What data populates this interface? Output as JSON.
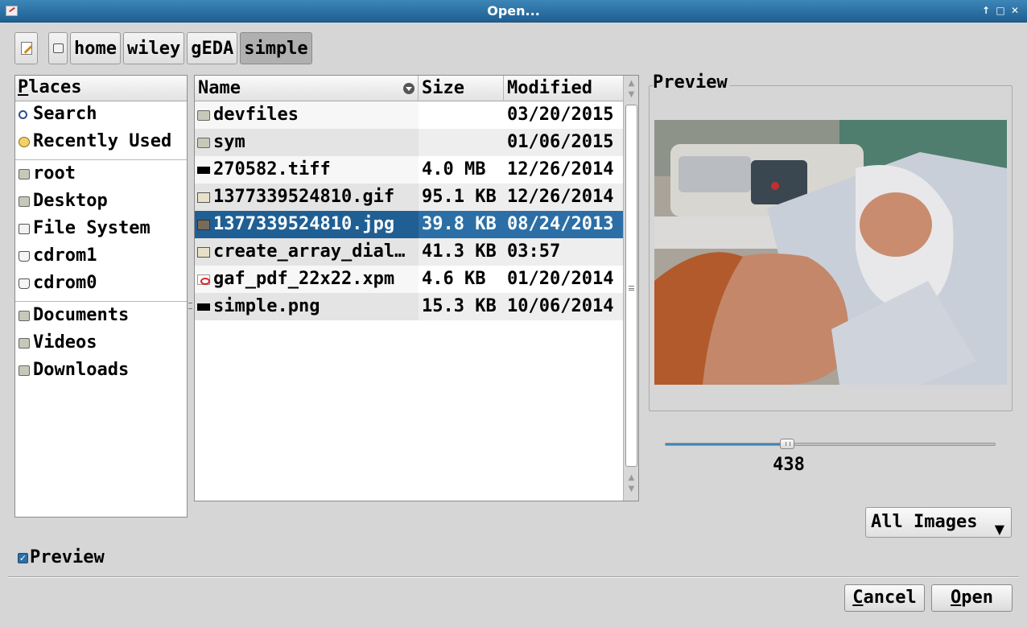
{
  "window": {
    "title": "Open..."
  },
  "path_bar": {
    "segments": [
      {
        "label": "home"
      },
      {
        "label": "wiley"
      },
      {
        "label": "gEDA"
      },
      {
        "label": "simple"
      }
    ]
  },
  "places": {
    "header_mnemonic": "P",
    "header_rest": "laces",
    "items": [
      {
        "label": "Search",
        "icon": "search-icon"
      },
      {
        "label": "Recently Used",
        "icon": "clock-icon"
      },
      {
        "label": "root",
        "icon": "home-folder-icon"
      },
      {
        "label": "Desktop",
        "icon": "desktop-folder-icon"
      },
      {
        "label": "File System",
        "icon": "drive-icon"
      },
      {
        "label": "cdrom1",
        "icon": "cdrom-icon"
      },
      {
        "label": "cdrom0",
        "icon": "cdrom-icon"
      },
      {
        "label": "Documents",
        "icon": "folder-icon"
      },
      {
        "label": "Videos",
        "icon": "folder-icon"
      },
      {
        "label": "Downloads",
        "icon": "folder-icon"
      }
    ]
  },
  "file_list": {
    "columns": {
      "name": "Name",
      "size": "Size",
      "modified": "Modified"
    },
    "rows": [
      {
        "name": "devfiles",
        "size": "",
        "modified": "03/20/2015",
        "icon": "folder-icon"
      },
      {
        "name": "sym",
        "size": "",
        "modified": "01/06/2015",
        "icon": "folder-icon"
      },
      {
        "name": "270582.tiff",
        "size": "4.0 MB",
        "modified": "12/26/2014",
        "icon": "image-file-icon"
      },
      {
        "name": "1377339524810.gif",
        "size": "95.1 KB",
        "modified": "12/26/2014",
        "icon": "image-file-icon"
      },
      {
        "name": "1377339524810.jpg",
        "size": "39.8 KB",
        "modified": "08/24/2013",
        "icon": "image-file-icon",
        "selected": true
      },
      {
        "name": "create_array_dial…",
        "size": "41.3 KB",
        "modified": "03:57",
        "icon": "image-file-icon"
      },
      {
        "name": "gaf_pdf_22x22.xpm",
        "size": "4.6 KB",
        "modified": "01/20/2014",
        "icon": "pdf-file-icon"
      },
      {
        "name": "simple.png",
        "size": "15.3 KB",
        "modified": "10/06/2014",
        "icon": "image-file-icon"
      }
    ]
  },
  "preview": {
    "label": "Preview",
    "slider_value": "438",
    "slider_fraction": 0.37
  },
  "filter": {
    "selected": "All Images"
  },
  "preview_checkbox": {
    "label": "Preview",
    "checked": true
  },
  "buttons": {
    "cancel_mnemonic": "C",
    "cancel_rest": "ancel",
    "open_mnemonic": "O",
    "open_rest": "pen"
  },
  "colors": {
    "selection": "#2c6fa6",
    "titlebar": "#2a6ea2"
  }
}
